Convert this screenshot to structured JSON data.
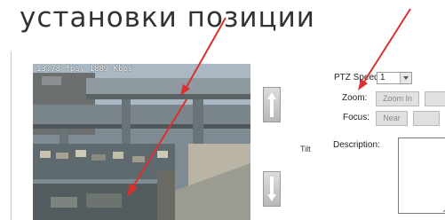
{
  "heading": "установки позиции",
  "video": {
    "overlay": "13.78 fps, 1889 Kbps"
  },
  "ptz": {
    "tilt_label": "Tilt",
    "speed_label": "PTZ Speed:",
    "speed_value": "1",
    "zoom_label": "Zoom:",
    "zoom_in_label": "Zoom In",
    "focus_label": "Focus:",
    "focus_near_label": "Near",
    "description_label": "Description:"
  },
  "colors": {
    "annotation_arrow": "#d93030"
  }
}
